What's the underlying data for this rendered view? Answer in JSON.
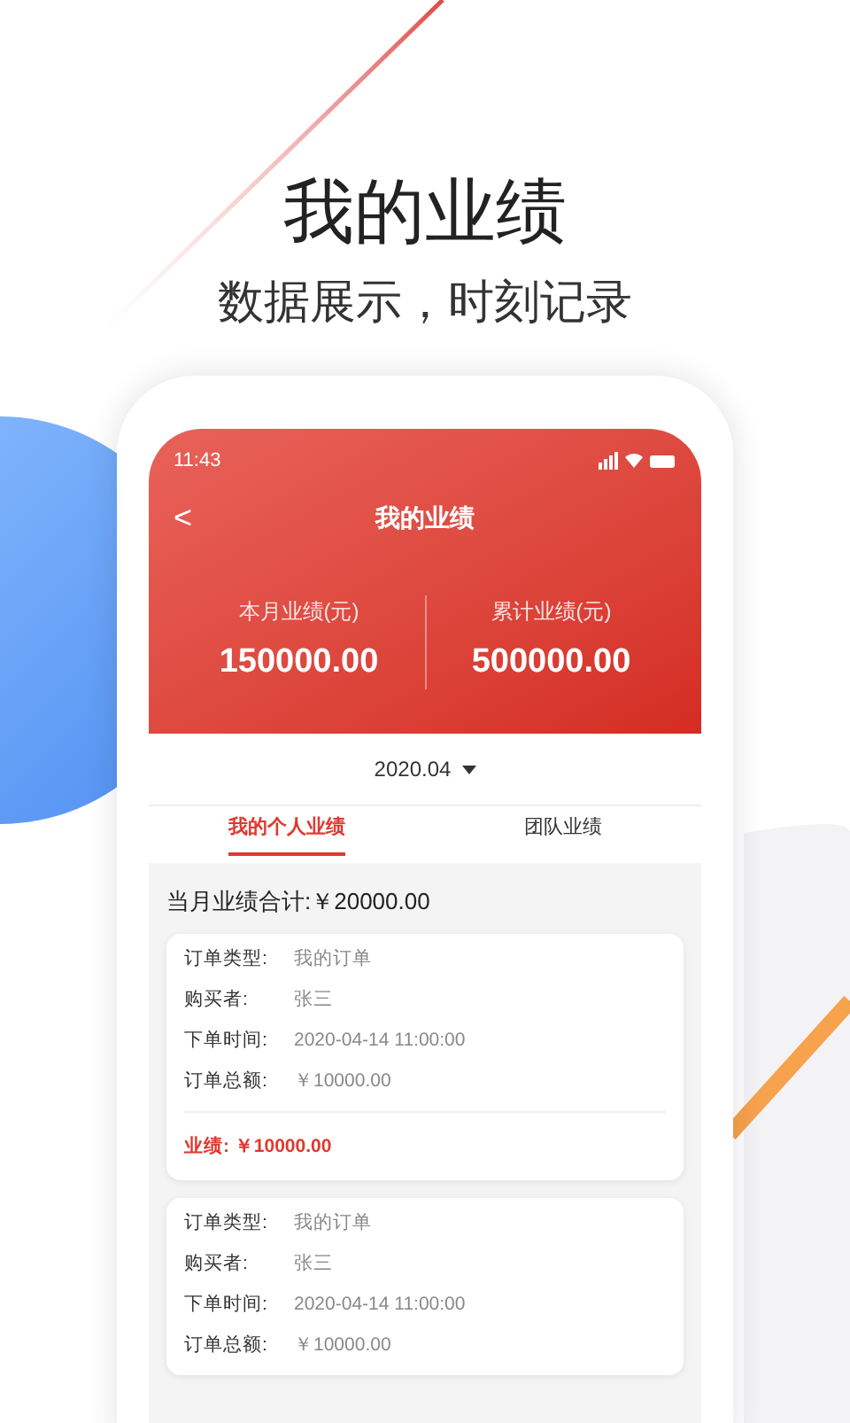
{
  "headline": {
    "title": "我的业绩",
    "subtitle": "数据展示，时刻记录"
  },
  "status_bar": {
    "time": "11:43"
  },
  "nav": {
    "back": "<",
    "title": "我的业绩"
  },
  "stats": [
    {
      "label": "本月业绩(元)",
      "value": "150000.00"
    },
    {
      "label": "累计业绩(元)",
      "value": "500000.00"
    }
  ],
  "date_picker": {
    "value": "2020.04"
  },
  "tabs": [
    {
      "label": "我的个人业绩",
      "selected": true
    },
    {
      "label": "团队业绩",
      "selected": false
    }
  ],
  "summary": "当月业绩合计:￥20000.00",
  "orders": [
    {
      "fields": [
        {
          "label": "订单类型:",
          "value": "我的订单"
        },
        {
          "label": "购买者:",
          "value": "张三"
        },
        {
          "label": "下单时间:",
          "value": "2020-04-14  11:00:00"
        },
        {
          "label": "订单总额:",
          "value": "￥10000.00"
        }
      ],
      "performance": "业绩: ￥10000.00"
    },
    {
      "fields": [
        {
          "label": "订单类型:",
          "value": "我的订单"
        },
        {
          "label": "购买者:",
          "value": "张三"
        },
        {
          "label": "下单时间:",
          "value": "2020-04-14  11:00:00"
        },
        {
          "label": "订单总额:",
          "value": "￥10000.00"
        }
      ]
    }
  ]
}
